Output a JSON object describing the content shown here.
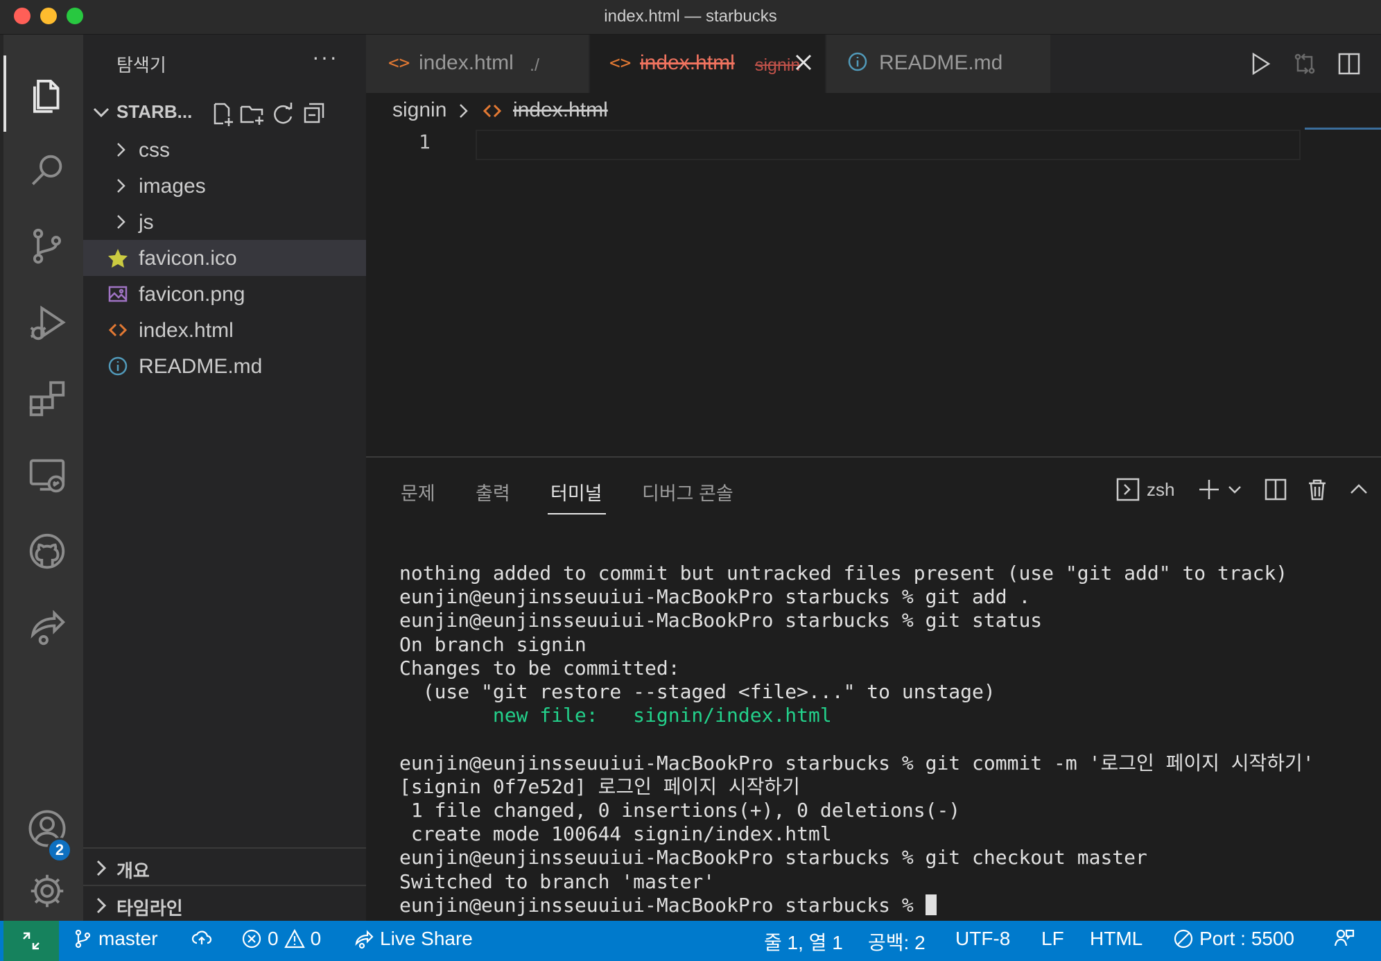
{
  "window": {
    "title": "index.html — starbucks"
  },
  "activity_bar": {
    "items": [
      "explorer-icon",
      "search-icon",
      "source-control-icon",
      "run-debug-icon",
      "extensions-icon",
      "remote-explorer-icon",
      "github-icon",
      "live-share-icon",
      "account-icon",
      "gear-icon"
    ],
    "account_badge": "2"
  },
  "sidebar": {
    "title": "탐색기",
    "more": "···",
    "folder_name": "STARB...",
    "tree": [
      {
        "label": "css",
        "type": "folder"
      },
      {
        "label": "images",
        "type": "folder"
      },
      {
        "label": "js",
        "type": "folder"
      },
      {
        "label": "favicon.ico",
        "type": "file",
        "icon": "star-icon",
        "selected": true
      },
      {
        "label": "favicon.png",
        "type": "file",
        "icon": "image-file-icon"
      },
      {
        "label": "index.html",
        "type": "file",
        "icon": "html-file-icon"
      },
      {
        "label": "README.md",
        "type": "file",
        "icon": "info-icon"
      }
    ],
    "outline": "개요",
    "timeline": "타임라인"
  },
  "tabs": [
    {
      "name": "index.html",
      "desc": "./",
      "icon": "<>"
    },
    {
      "name": "index.html",
      "desc": "signin",
      "icon": "<>",
      "active": true,
      "deleted": true
    },
    {
      "name": "README.md",
      "desc": "",
      "icon": "info-icon"
    }
  ],
  "breadcrumb": {
    "folder": "signin",
    "file": "index.html"
  },
  "editor": {
    "line_numbers": [
      "1"
    ]
  },
  "panel": {
    "tabs": [
      "문제",
      "출력",
      "터미널",
      "디버그 콘솔"
    ],
    "active_tab": "터미널",
    "shell": "zsh"
  },
  "terminal": {
    "lines": [
      "nothing added to commit but untracked files present (use \"git add\" to track)",
      "eunjin@eunjinsseuuiui-MacBookPro starbucks % git add .",
      "eunjin@eunjinsseuuiui-MacBookPro starbucks % git status",
      "On branch signin",
      "Changes to be committed:",
      "  (use \"git restore --staged <file>...\" to unstage)",
      "        new file:   signin/index.html",
      "",
      "eunjin@eunjinsseuuiui-MacBookPro starbucks % git commit -m '로그인 페이지 시작하기'",
      "[signin 0f7e52d] 로그인 페이지 시작하기",
      " 1 file changed, 0 insertions(+), 0 deletions(-)",
      " create mode 100644 signin/index.html",
      "eunjin@eunjinsseuuiui-MacBookPro starbucks % git checkout master",
      "Switched to branch 'master'",
      "eunjin@eunjinsseuuiui-MacBookPro starbucks % "
    ]
  },
  "statusbar": {
    "branch": "master",
    "errors": "0",
    "warnings": "0",
    "live_share": "Live Share",
    "position": "줄 1, 열 1",
    "spaces": "공백: 2",
    "encoding": "UTF-8",
    "eol": "LF",
    "language": "HTML",
    "port": "Port : 5500"
  },
  "colors": {
    "statusbar": "#007acc",
    "remote": "#16825d",
    "deleted_tab": "#f0735f",
    "terminal_green": "#23d18b"
  }
}
